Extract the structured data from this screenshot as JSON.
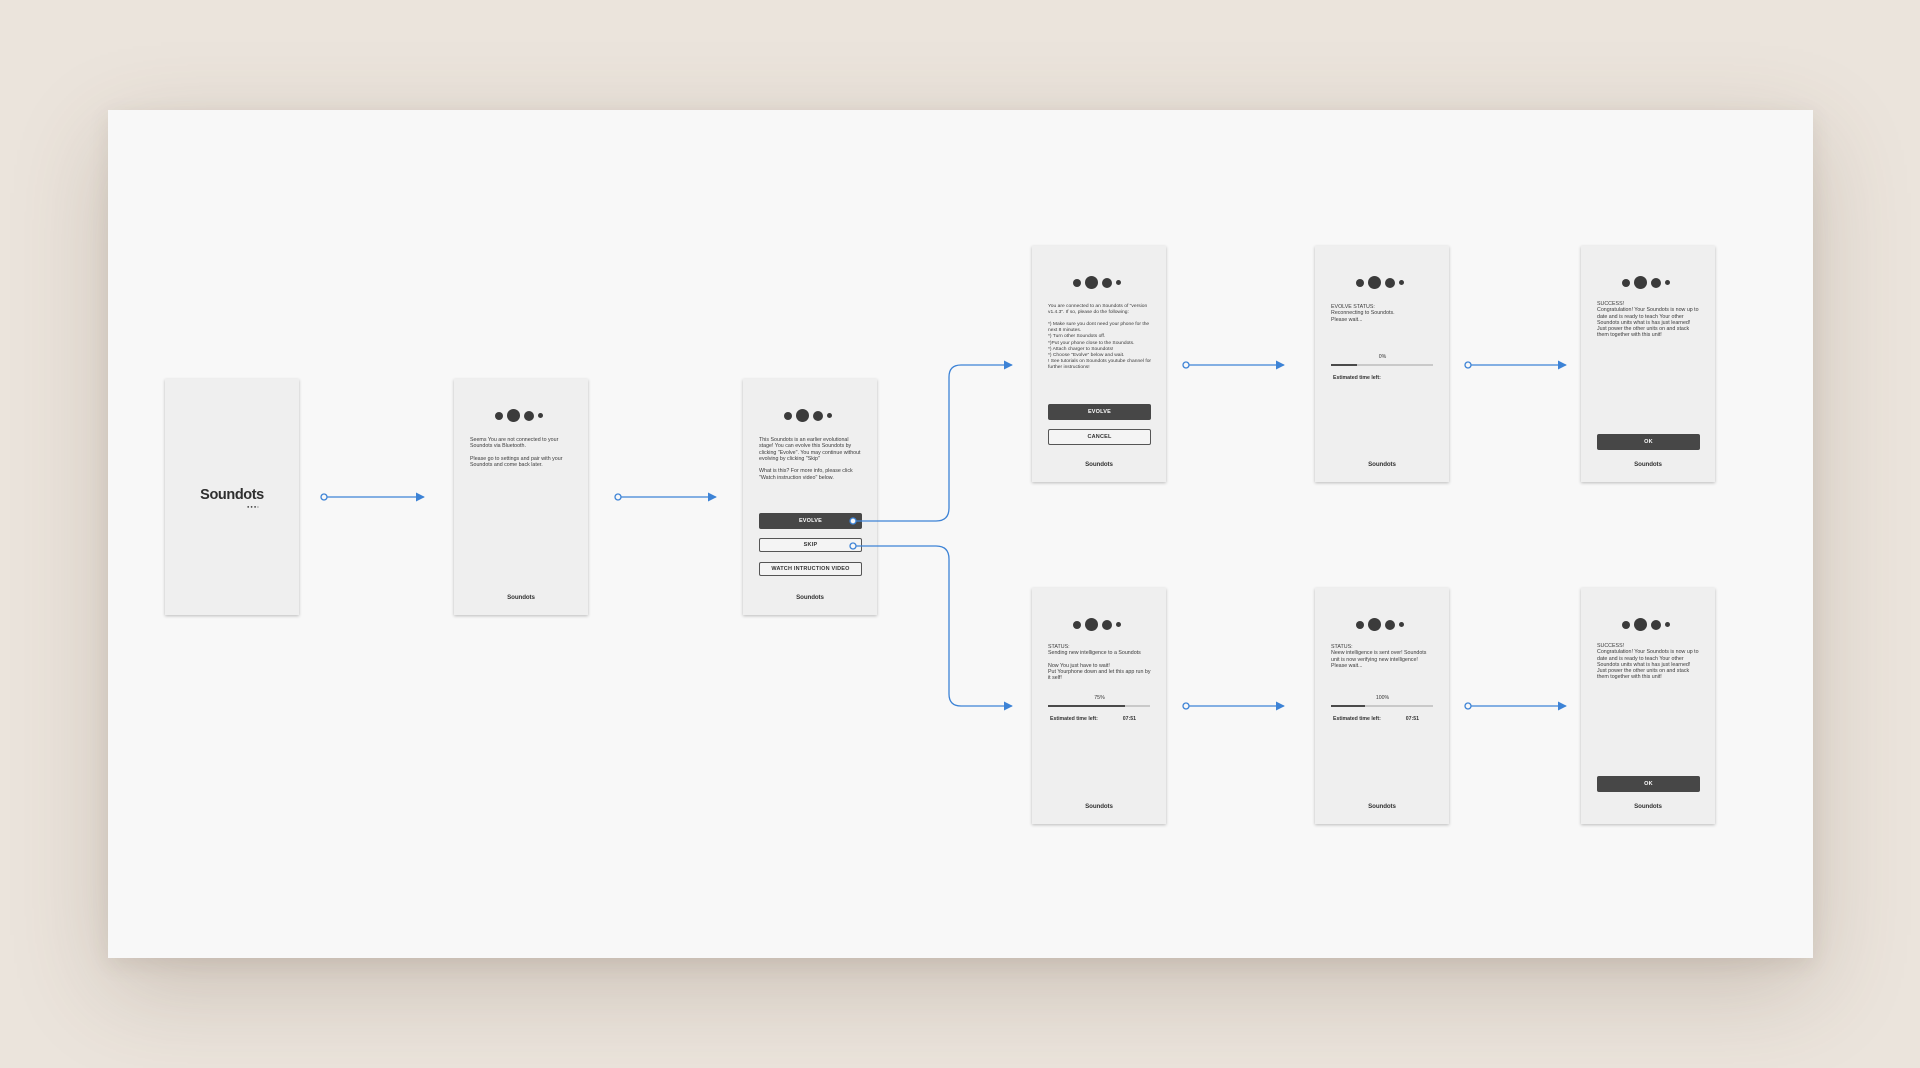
{
  "brand": {
    "logo_text": "Soundots",
    "logo_sub": "●●●•",
    "footer_text": "Soundots"
  },
  "colors": {
    "connector": "#3d83d6",
    "dark_button": "#474747",
    "screen_bg": "#efefef",
    "board_bg": "#f8f8f8",
    "page_bg": "#ebe4dc"
  },
  "screens": {
    "splash": {},
    "not_connected": {
      "message": "Seems You are not connected to your Soundots via Bluetooth.\n\nPlease go to settings and pair with your Soundots and come back later."
    },
    "evolve_prompt": {
      "message": "This Soundots is an earlier evolutional stage! You can evolve this Soundots by clicking \"Evolve\". You may continue without evolving by clicking \"Skip\"\n\nWhat is this? For more info, please click \"Watch instruction video\" below.",
      "evolve_label": "EVOLVE",
      "skip_label": "SKIP",
      "video_label": "WATCH INTRUCTION VIDEO"
    },
    "evolve_instructions": {
      "message": "You are connected to an Soundots of \"version v1.4.3\". If so, please do the following:\n\n*) Make sure you dont need your phone for the next 8 minutes.\n*) Turn other Soundots off.\n*)Put your phone close to the Soundots.\n*) Attach charger to Soundots!\n*) Choose \"Evolve\" below and wait.\n! See tutorials on Soundots youtube channel for further instructions!",
      "evolve_label": "EVOLVE",
      "cancel_label": "CANCEL"
    },
    "evolve_status": {
      "message": "EVOLVE STATUS:\nReconnecting to Soundots.\nPlease wait...",
      "progress_label": "0%",
      "progress": 0.25,
      "eta_label": "Estimated time left:"
    },
    "success_top": {
      "message": "SUCCESS!\nCongratulation! Your Soundots is now up to date and is ready to teach Your other Soundots units what is has just learned! Just power the other units on and stack them together with this unit!",
      "ok_label": "OK"
    },
    "sending": {
      "message": "STATUS:\nSending new intelligence to a Soundots\n\nNow You just have to wait!\nPut Yourphone down and let this app run by it self!",
      "progress_label": "75%",
      "progress": 0.75,
      "eta_label": "Estimated time left:",
      "eta_value": "07:51"
    },
    "verifying": {
      "message": "STATUS:\nNeew intelligence is sent over! Soundots unit is now verifying new intelligence!\nPlease wait...",
      "progress_label": "100%",
      "progress": 0.33,
      "eta_label": "Estimated time left:",
      "eta_value": "07:51"
    },
    "success_bottom": {
      "message": "SUCCESS!\nCongratulation! Your Soundots is now up to date and is ready to teach Your other Soundots units what is has just learned! Just power the other units on and stack them together with this unit!",
      "ok_label": "OK"
    }
  }
}
